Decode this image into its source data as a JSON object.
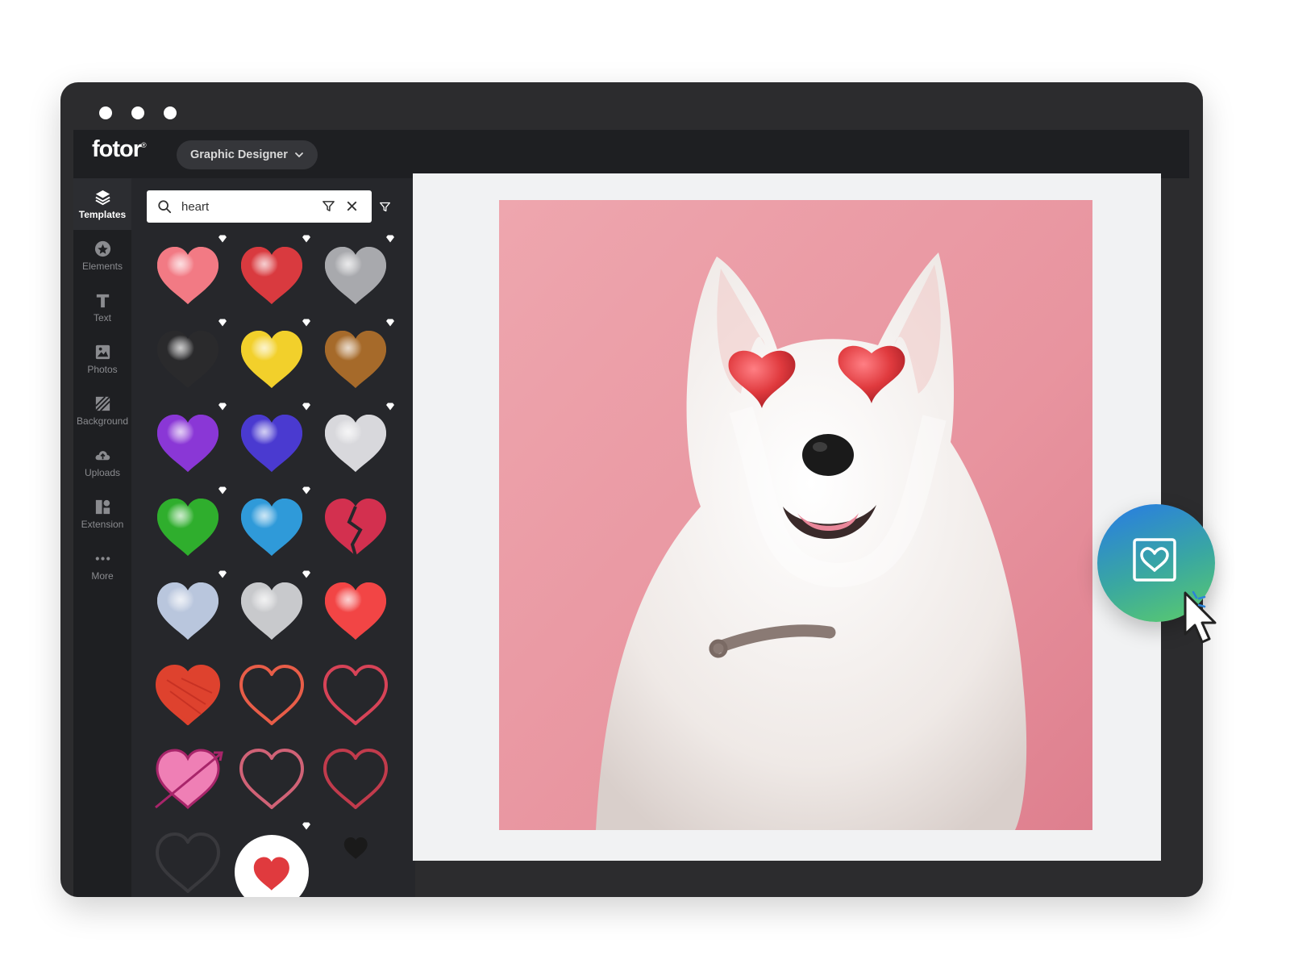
{
  "app": {
    "logo_text": "fotor",
    "logo_mark": "®"
  },
  "header": {
    "role_button_label": "Graphic Designer"
  },
  "sidebar": {
    "items": [
      {
        "label": "Templates",
        "icon": "layers-icon",
        "active": true
      },
      {
        "label": "Elements",
        "icon": "elements-icon",
        "active": false
      },
      {
        "label": "Text",
        "icon": "text-icon",
        "active": false
      },
      {
        "label": "Photos",
        "icon": "photos-icon",
        "active": false
      },
      {
        "label": "Background",
        "icon": "background-icon",
        "active": false
      },
      {
        "label": "Uploads",
        "icon": "upload-cloud-icon",
        "active": false
      },
      {
        "label": "Extension",
        "icon": "extension-icon",
        "active": false
      },
      {
        "label": "More",
        "icon": "more-icon",
        "active": false
      }
    ]
  },
  "search": {
    "value": "heart",
    "placeholder": ""
  },
  "stickers": [
    {
      "name": "pink-3d-heart",
      "color": "#f27a84",
      "premium": true
    },
    {
      "name": "red-3d-heart",
      "color": "#d93a3f",
      "premium": true
    },
    {
      "name": "silver-chrome-heart",
      "color": "#a8a9ad",
      "premium": true
    },
    {
      "name": "black-3d-heart",
      "color": "#2a2a2c",
      "premium": true
    },
    {
      "name": "yellow-3d-heart",
      "color": "#f2d02b",
      "premium": true
    },
    {
      "name": "bronze-3d-heart",
      "color": "#a66a2a",
      "premium": true
    },
    {
      "name": "purple-3d-heart",
      "color": "#8a37d6",
      "premium": true
    },
    {
      "name": "blue-violet-3d-heart",
      "color": "#4a3ad0",
      "premium": true
    },
    {
      "name": "white-3d-heart",
      "color": "#d8d8dc",
      "premium": true
    },
    {
      "name": "green-3d-heart",
      "color": "#2fae2d",
      "premium": true
    },
    {
      "name": "sky-blue-3d-heart",
      "color": "#2f9ad9",
      "premium": true
    },
    {
      "name": "broken-heart",
      "color": "#d3304f",
      "premium": false
    },
    {
      "name": "holographic-heart",
      "color": "#b9c6dd",
      "premium": true
    },
    {
      "name": "silver-foil-heart",
      "color": "#c8c9cc",
      "premium": true
    },
    {
      "name": "coral-red-heart",
      "color": "#f24545",
      "premium": false
    },
    {
      "name": "scribble-red-heart",
      "color": "#e8442f",
      "premium": false
    },
    {
      "name": "outlined-coral-heart",
      "color": "#f2604a",
      "premium": false
    },
    {
      "name": "sketch-tilted-heart",
      "color": "#e0445a",
      "premium": false
    },
    {
      "name": "pink-arrow-heart",
      "color": "#ef7fb5",
      "premium": false
    },
    {
      "name": "outline-hearts-pair",
      "color": "#d9657a",
      "premium": false
    },
    {
      "name": "double-outline-hearts",
      "color": "#c93c4e",
      "premium": false
    },
    {
      "name": "dark-outline-hearts",
      "color": "#3a3a3e",
      "premium": false
    },
    {
      "name": "red-heart-white-circle",
      "color": "#e03a3e",
      "premium": true
    },
    {
      "name": "small-black-heart",
      "color": "#1a1a1a",
      "premium": false
    }
  ],
  "canvas": {
    "background": "#e8949f",
    "subject": "white samoyed dog with heart eyes"
  },
  "colors": {
    "window_bg": "#2c2c2e",
    "toolbar_bg": "#1e1f22",
    "panel_bg": "#26272b",
    "canvas_bg": "#f1f2f3",
    "fab_start": "#2b83d9",
    "fab_end": "#5ccc6a"
  },
  "fab": {
    "icon": "framed-heart-icon"
  }
}
